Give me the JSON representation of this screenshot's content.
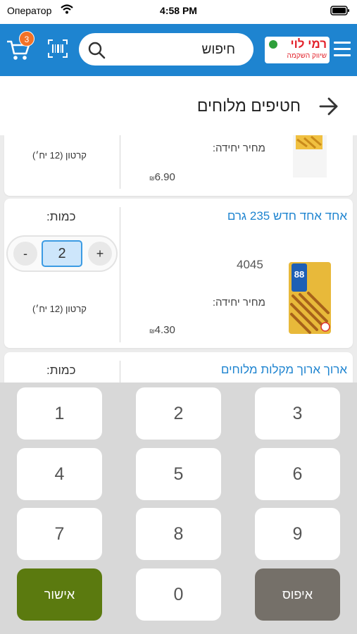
{
  "status_bar": {
    "carrier": "Оператор",
    "time": "4:58 PM"
  },
  "header": {
    "cart_count": "3",
    "search_placeholder": "חיפוש",
    "logo_name": "רמי לוי",
    "logo_tagline": "שיווק השקמה"
  },
  "page": {
    "title": "חטיפים מלוחים"
  },
  "products": [
    {
      "name": "",
      "unit_price_label": "מחיר יחידה:",
      "price": "6.90",
      "currency": "₪",
      "carton": "קרטון (12 יח׳)"
    },
    {
      "name": "אחד אחד חדש 235 גרם",
      "code": "4045",
      "unit_price_label": "מחיר יחידה:",
      "price": "4.30",
      "currency": "₪",
      "carton": "קרטון (12 יח׳)",
      "quantity_label": "כמות:",
      "quantity": "2",
      "minus": "-",
      "plus": "+"
    },
    {
      "name": "ארוך ארוך מקלות מלוחים",
      "quantity_label": "כמות:"
    }
  ],
  "keypad": {
    "keys": [
      "1",
      "2",
      "3",
      "4",
      "5",
      "6",
      "7",
      "8",
      "9",
      "0"
    ],
    "confirm": "אישור",
    "reset": "איפוס"
  },
  "colors": {
    "brand_blue": "#1e84d0",
    "badge_orange": "#f27227",
    "confirm_green": "#5b7a0f",
    "reset_gray": "#757069"
  }
}
